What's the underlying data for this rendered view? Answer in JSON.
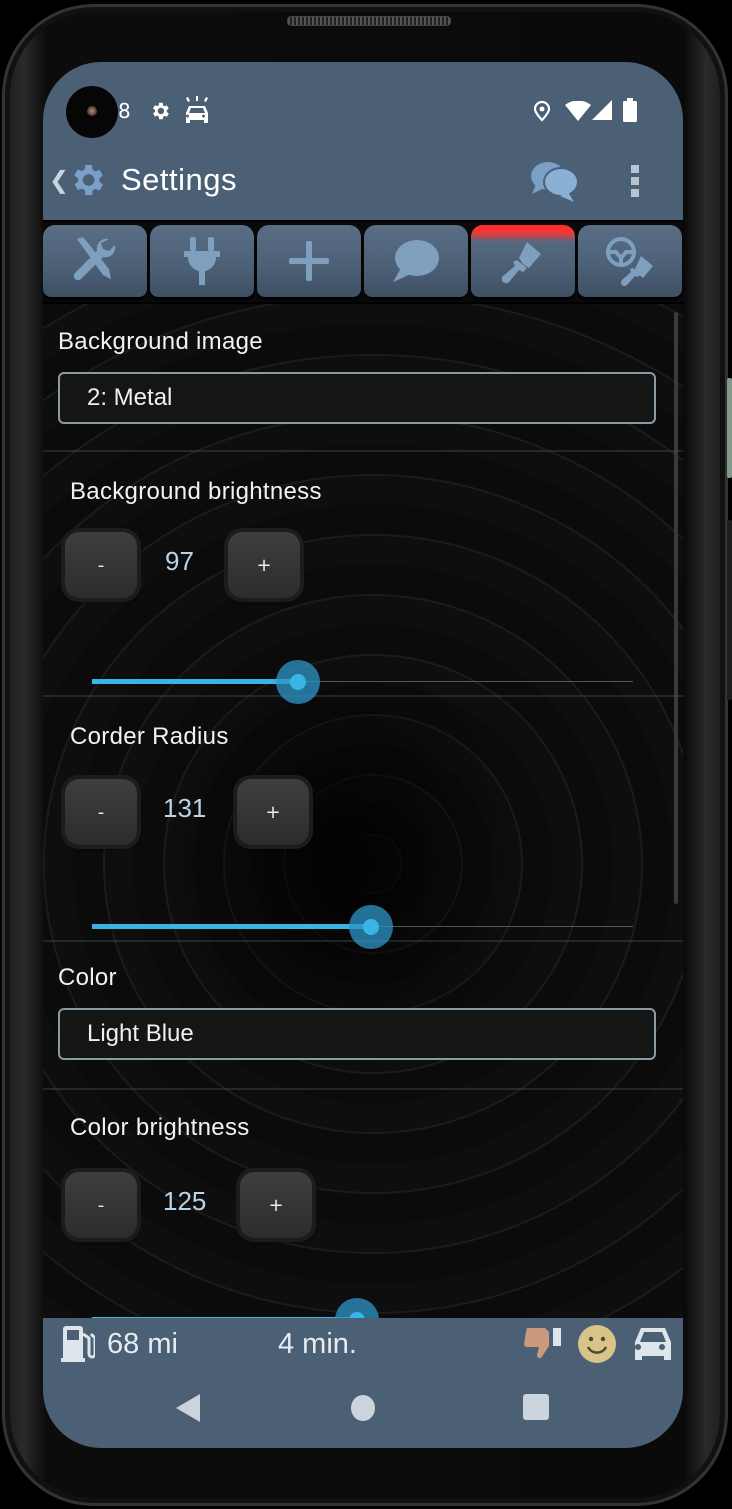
{
  "status_bar": {
    "notification_count": "8",
    "left_icons": [
      "gear-icon",
      "car-alert-icon"
    ],
    "right_icons": [
      "location-icon",
      "wifi-icon",
      "signal-icon",
      "battery-icon"
    ]
  },
  "app_bar": {
    "title": "Settings",
    "back_icon": "chevron-left-icon",
    "title_icon": "gear-icon",
    "actions": [
      "chat-bubbles-icon",
      "more-vertical-icon"
    ]
  },
  "tabs": [
    {
      "icon": "tools-icon",
      "active": false
    },
    {
      "icon": "plug-icon",
      "active": false
    },
    {
      "icon": "plus-icon",
      "active": false
    },
    {
      "icon": "speech-bubble-icon",
      "active": false
    },
    {
      "icon": "paintbrush-icon",
      "active": true
    },
    {
      "icon": "steering-wheel-brush-icon",
      "active": false
    }
  ],
  "settings": {
    "background_image": {
      "label": "Background image",
      "value": "2: Metal"
    },
    "background_brightness": {
      "label": "Background brightness",
      "value": "97",
      "minus": "-",
      "plus": "+",
      "slider_fraction": 0.38
    },
    "corner_radius": {
      "label": "Corder Radius",
      "value": "131",
      "minus": "-",
      "plus": "+",
      "slider_fraction": 0.515
    },
    "color": {
      "label": "Color",
      "value": "Light Blue"
    },
    "color_brightness": {
      "label": "Color brightness",
      "value": "125",
      "minus": "-",
      "plus": "+",
      "slider_fraction": 0.49
    }
  },
  "bottom_bar": {
    "range": "68 mi",
    "time": "4 min.",
    "icons": [
      "fuel-pump-icon",
      "thumbs-down-icon",
      "smiley-icon",
      "car-icon"
    ]
  },
  "colors": {
    "bar": "#4b5f75",
    "accent": "#3ab4e4",
    "active_tab": "#ff3333"
  }
}
